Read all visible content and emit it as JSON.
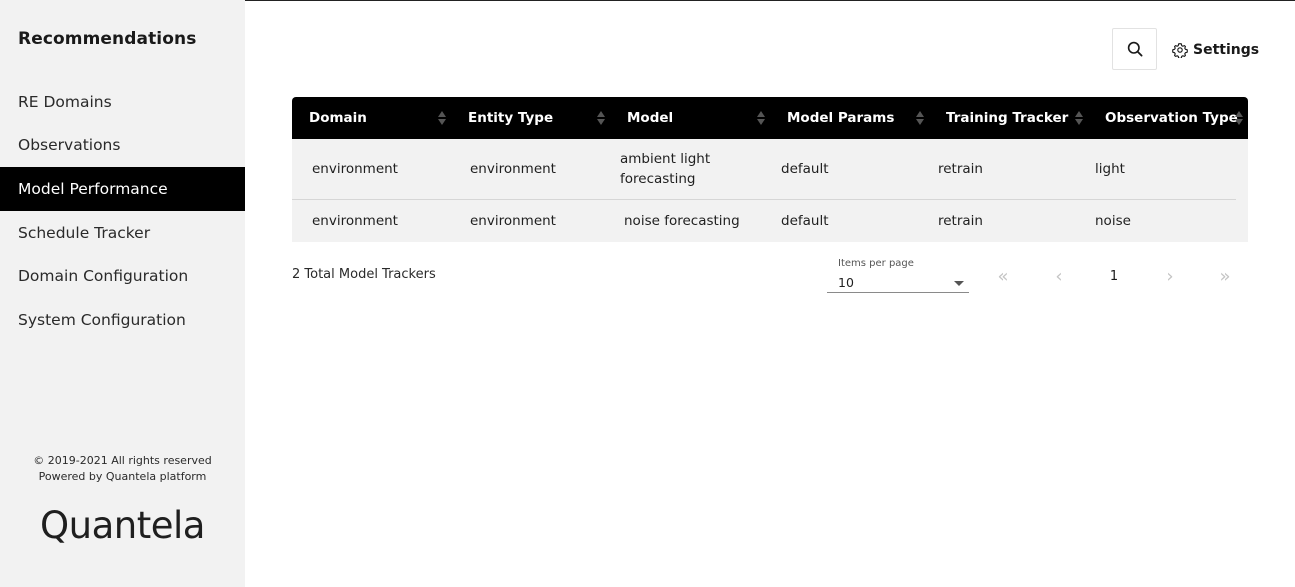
{
  "sidebar": {
    "title": "Recommendations",
    "items": [
      {
        "label": "RE Domains",
        "active": false
      },
      {
        "label": "Observations",
        "active": false
      },
      {
        "label": "Model Performance",
        "active": true
      },
      {
        "label": "Schedule Tracker",
        "active": false
      },
      {
        "label": "Domain Configuration",
        "active": false
      },
      {
        "label": "System Configuration",
        "active": false
      }
    ],
    "copyright_line1": "© 2019-2021 All rights reserved",
    "copyright_line2": "Powered by Quantela platform",
    "brand": "Quantela"
  },
  "toolbar": {
    "search_icon": "search-icon",
    "settings_icon": "gear-icon",
    "settings_label": "Settings"
  },
  "table": {
    "columns": [
      "Domain",
      "Entity Type",
      "Model",
      "Model Params",
      "Training Tracker",
      "Observation Type"
    ],
    "rows": [
      [
        "environment",
        "environment",
        "ambient light forecasting",
        "default",
        "retrain",
        "light"
      ],
      [
        "environment",
        "environment",
        "noise forecasting",
        "default",
        "retrain",
        "noise"
      ]
    ]
  },
  "footer": {
    "total_text": "2 Total Model Trackers",
    "items_per_page_label": "Items per page",
    "items_per_page_value": "10",
    "current_page": "1"
  },
  "colors": {
    "header_bg": "#000000",
    "sidebar_bg": "#f2f2f2",
    "active_item_bg": "#000000",
    "table_body_bg": "#f2f2f2"
  }
}
